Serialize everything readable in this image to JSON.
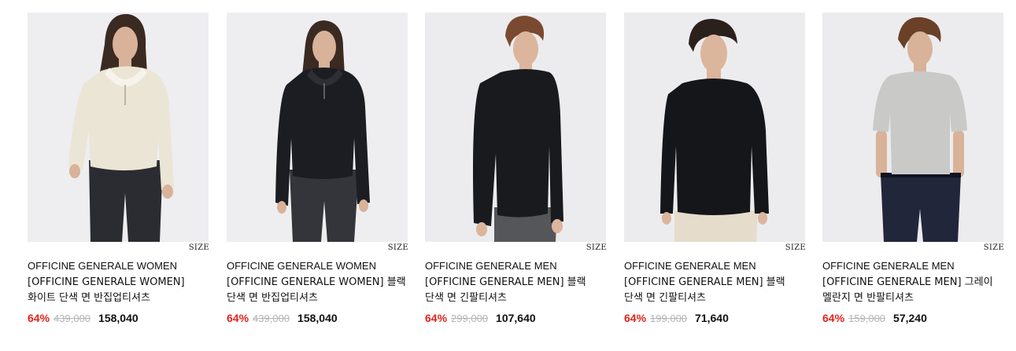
{
  "products": [
    {
      "size_label": "SIZE",
      "brand": "OFFICINE GENERALE WOMEN",
      "name": "[OFFICINE GENERALE WOMEN] 화이트 단색 면 반집업티셔츠",
      "discount": "64%",
      "original_price": "439,000",
      "final_price": "158,040",
      "colors": {
        "background": "#eeedf0",
        "top": "#ebe5d6",
        "bottom": "#2a2c31",
        "skin": "#d9b29a",
        "hair": "#3b2a22"
      }
    },
    {
      "size_label": "SIZE",
      "brand": "OFFICINE GENERALE WOMEN",
      "name": "[OFFICINE GENERALE WOMEN] 블랙 단색 면 반집업티셔츠",
      "discount": "64%",
      "original_price": "439,000",
      "final_price": "158,040",
      "colors": {
        "background": "#eeedf0",
        "top": "#1c1d22",
        "bottom": "#33353a",
        "skin": "#d9b29a",
        "hair": "#3b2a22"
      }
    },
    {
      "size_label": "SIZE",
      "brand": "OFFICINE GENERALE MEN",
      "name": "[OFFICINE GENERALE MEN] 블랙 단색 면 긴팔티셔츠",
      "discount": "64%",
      "original_price": "299,000",
      "final_price": "107,640",
      "colors": {
        "background": "#ececee",
        "top": "#191a1e",
        "bottom": "#55565a",
        "skin": "#dcb59d",
        "hair": "#7a4a30"
      }
    },
    {
      "size_label": "SIZE",
      "brand": "OFFICINE GENERALE MEN",
      "name": "[OFFICINE GENERALE MEN] 블랙 단색 면 긴팔티셔츠",
      "discount": "64%",
      "original_price": "199,000",
      "final_price": "71,640",
      "colors": {
        "background": "#ececee",
        "top": "#15161a",
        "bottom": "#e5dccb",
        "skin": "#dcb59d",
        "hair": "#2b211c"
      }
    },
    {
      "size_label": "SIZE",
      "brand": "OFFICINE GENERALE MEN",
      "name": "[OFFICINE GENERALE MEN] 그레이 멜란지 면 반팔티셔츠",
      "discount": "64%",
      "original_price": "159,000",
      "final_price": "57,240",
      "colors": {
        "background": "#ececee",
        "top": "#c9c9c8",
        "bottom": "#22263a",
        "skin": "#d9b29a",
        "hair": "#6b4028"
      }
    }
  ],
  "accent_color": "#e2231a"
}
